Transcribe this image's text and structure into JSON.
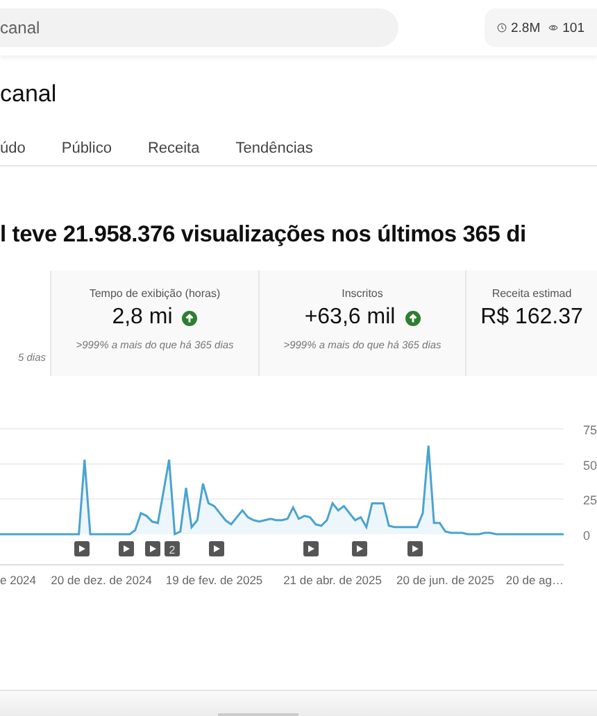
{
  "search": {
    "placeholder": "canal"
  },
  "top_stats": [
    {
      "value": "2.8M"
    },
    {
      "value": "101"
    }
  ],
  "page_title": "canal",
  "tabs": [
    {
      "label": "údo",
      "selected": false
    },
    {
      "label": "Público",
      "selected": false
    },
    {
      "label": "Receita",
      "selected": false
    },
    {
      "label": "Tendências",
      "selected": false
    }
  ],
  "headline": "l teve 21.958.376 visualizações nos últimos 365 di",
  "stat_cards": [
    {
      "note": "5 dias"
    },
    {
      "title": "Tempo de exibição (horas)",
      "value": "2,8 mi",
      "trend_up": true,
      "note": ">999% a mais do que há 365 dias"
    },
    {
      "title": "Inscritos",
      "value": "+63,6 mil",
      "trend_up": true,
      "note": ">999% a mais do que há 365 dias"
    },
    {
      "title": "Receita estimad",
      "value": "R$ 162.37"
    }
  ],
  "chart": {
    "chart_data": {
      "type": "area",
      "categories": [
        "e 2024",
        null,
        null,
        null,
        null,
        null,
        null,
        null,
        null,
        null,
        null,
        null,
        null,
        null,
        null,
        null,
        null,
        null,
        "20 de dez. de 2024",
        null,
        null,
        null,
        null,
        null,
        null,
        null,
        null,
        null,
        null,
        null,
        null,
        null,
        null,
        null,
        null,
        null,
        null,
        null,
        "19 de fev. de 2025",
        null,
        null,
        null,
        null,
        null,
        null,
        null,
        null,
        null,
        null,
        null,
        null,
        null,
        null,
        null,
        null,
        null,
        null,
        null,
        null,
        "21 de abr. de 2025",
        null,
        null,
        null,
        null,
        null,
        null,
        null,
        null,
        null,
        null,
        null,
        null,
        null,
        null,
        null,
        null,
        null,
        null,
        null,
        "20 de jun. de 2025",
        null,
        null,
        null,
        null,
        null,
        null,
        null,
        null,
        null,
        null,
        null,
        null,
        null,
        null,
        null,
        null,
        null,
        null,
        null,
        null,
        "20 de ag…"
      ],
      "ylim": [
        0,
        75
      ],
      "yticks": [
        0,
        25,
        50,
        75
      ],
      "series": [
        {
          "color": "#4aa3d0",
          "values": [
            0,
            0,
            0,
            0,
            0,
            0,
            0,
            0,
            0,
            0,
            0,
            0,
            0,
            0,
            0,
            53,
            0,
            0,
            0,
            0,
            0,
            0,
            0,
            0,
            3,
            15,
            13,
            9,
            8,
            30,
            53,
            0,
            2,
            33,
            5,
            10,
            36,
            22,
            20,
            15,
            10,
            7,
            12,
            17,
            12,
            10,
            9,
            10,
            11,
            10,
            10,
            11,
            19,
            11,
            13,
            12,
            7,
            6,
            10,
            22,
            17,
            20,
            15,
            10,
            12,
            5,
            22,
            22,
            22,
            6,
            5,
            5,
            5,
            5,
            5,
            15,
            63,
            8,
            8,
            2,
            1,
            1,
            1,
            0,
            0,
            0,
            1,
            1,
            0,
            0,
            0,
            0,
            0,
            0,
            0,
            0,
            0,
            0,
            0,
            0,
            0
          ]
        }
      ]
    },
    "video_markers": [
      {
        "kind": "video"
      },
      {
        "kind": "video"
      },
      {
        "kind": "video"
      },
      {
        "kind": "count",
        "label": "2"
      },
      {
        "kind": "video"
      },
      {
        "kind": "video"
      },
      {
        "kind": "video"
      },
      {
        "kind": "video"
      }
    ]
  }
}
